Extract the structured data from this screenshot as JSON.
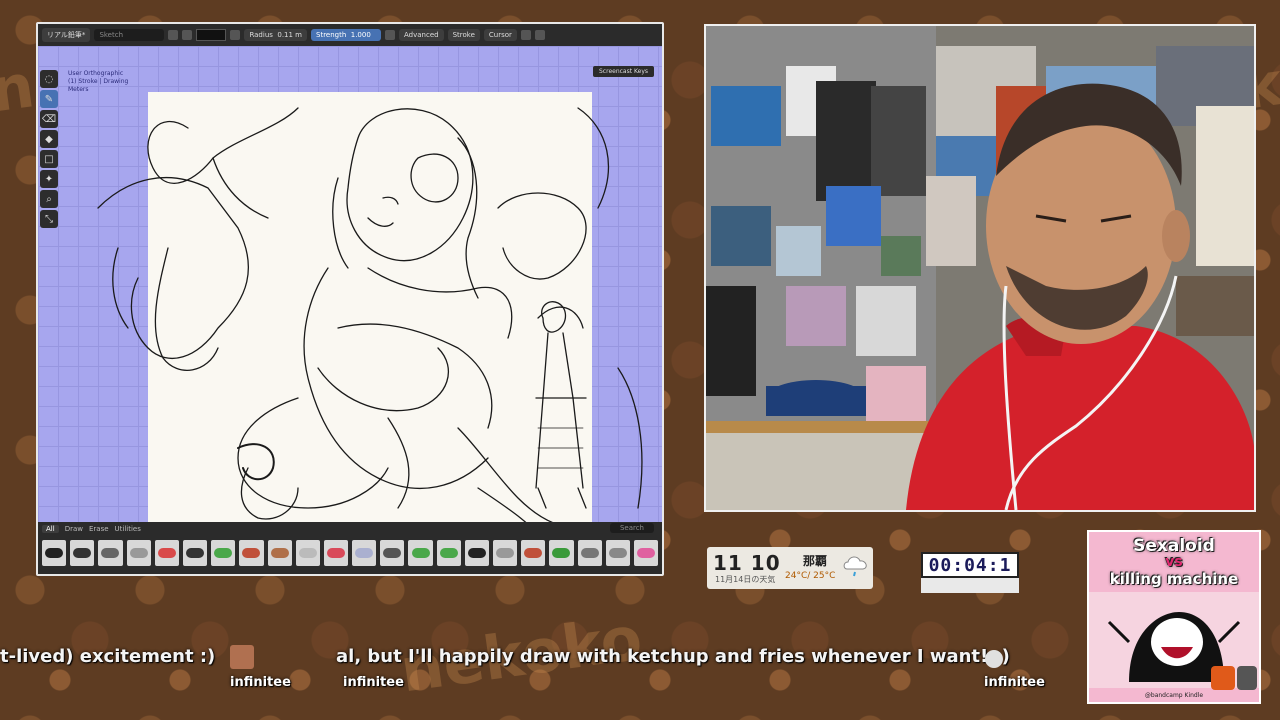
{
  "blender": {
    "mode_label": "リアル鉛筆*",
    "search_placeholder": "Sketch",
    "radius_label": "Radius",
    "radius_value": "0.11 m",
    "strength_label": "Strength",
    "strength_value": "1.000",
    "menus": [
      "Advanced",
      "Stroke",
      "Cursor"
    ],
    "screencast_label": "Screencast Keys",
    "viewport_info": [
      "User Orthographic",
      "(1) Stroke | Drawing",
      "Meters"
    ],
    "brush_tabs": [
      "All",
      "Draw",
      "Erase",
      "Utilities"
    ],
    "brush_search_placeholder": "Search",
    "brush_colors": [
      "#222222",
      "#333333",
      "#666666",
      "#999999",
      "#d94a4a",
      "#333333",
      "#4aa84a",
      "#c0503a",
      "#b0704a",
      "#bbbbbb",
      "#d94a5a",
      "#aab0d0",
      "#555555",
      "#4aa84a",
      "#4aa84a",
      "#222222",
      "#999999",
      "#c0503a",
      "#3a9a3a",
      "#777777",
      "#888888",
      "#e060a0"
    ]
  },
  "clock_widget": {
    "time": "11 10",
    "date": "11月14日の天気",
    "city": "那覇",
    "temp": "24°C/ 25°C"
  },
  "timer": {
    "value": "00:04:1"
  },
  "poster": {
    "title_line1": "Sexaloid",
    "title_vs": "vs",
    "title_line2": "killing machine",
    "credit": "@bandcamp Kindle"
  },
  "ticker": {
    "messages": [
      {
        "text": "t-lived) excitement :)",
        "user": "infinitee"
      },
      {
        "text": "al, but I'll happily draw with ketchup and fries whenever I want! :)",
        "user": "infinitee"
      },
      {
        "text": "",
        "user": "infinitee"
      }
    ]
  },
  "background_word": "nekoko",
  "colors": {
    "viewport_bg": "#a7a6ee",
    "paper": "#faf8f2",
    "blender_accent": "#4772b3",
    "shirt_red": "#d4212b"
  }
}
